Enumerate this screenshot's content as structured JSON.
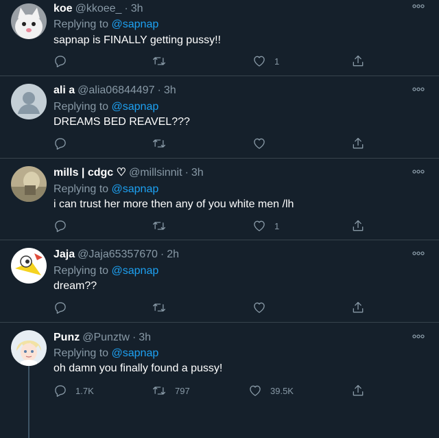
{
  "tweets": [
    {
      "name": "koe",
      "handle": "@kkoee_",
      "time": "3h",
      "replying_prefix": "Replying to",
      "replying_to": "@sapnap",
      "text": "sapnap is FINALLY getting pussy!!",
      "reply_count": "",
      "retweet_count": "",
      "like_count": "1",
      "avatar": "white-kitten-avatar"
    },
    {
      "name": "ali a",
      "handle": "@alia06844497",
      "time": "3h",
      "replying_prefix": "Replying to",
      "replying_to": "@sapnap",
      "text": "DREAMS BED REAVEL???",
      "reply_count": "",
      "retweet_count": "",
      "like_count": "",
      "avatar": "default-profile-avatar"
    },
    {
      "name": "mills | cdgc ♡",
      "handle": "@millsinnit",
      "time": "3h",
      "replying_prefix": "Replying to",
      "replying_to": "@sapnap",
      "text": "i can trust her more then any of you white men /lh",
      "reply_count": "",
      "retweet_count": "",
      "like_count": "1",
      "avatar": "photo-avatar"
    },
    {
      "name": "Jaja",
      "handle": "@Jaja65357670",
      "time": "2h",
      "replying_prefix": "Replying to",
      "replying_to": "@sapnap",
      "text": "dream??",
      "reply_count": "",
      "retweet_count": "",
      "like_count": "",
      "avatar": "cartoon-bird-avatar"
    },
    {
      "name": "Punz",
      "handle": "@Punztw",
      "time": "3h",
      "replying_prefix": "Replying to",
      "replying_to": "@sapnap",
      "text": "oh damn you finally found a pussy!",
      "reply_count": "1.7K",
      "retweet_count": "797",
      "like_count": "39.5K",
      "avatar": "anime-character-avatar"
    }
  ],
  "icons": {
    "reply": "reply-icon",
    "retweet": "retweet-icon",
    "like": "heart-icon",
    "share": "share-icon",
    "more": "more-options-icon"
  },
  "colors": {
    "background": "#15202b",
    "divider": "#38444d",
    "muted": "#8899a6",
    "link": "#1da1f2",
    "text": "#ffffff"
  }
}
